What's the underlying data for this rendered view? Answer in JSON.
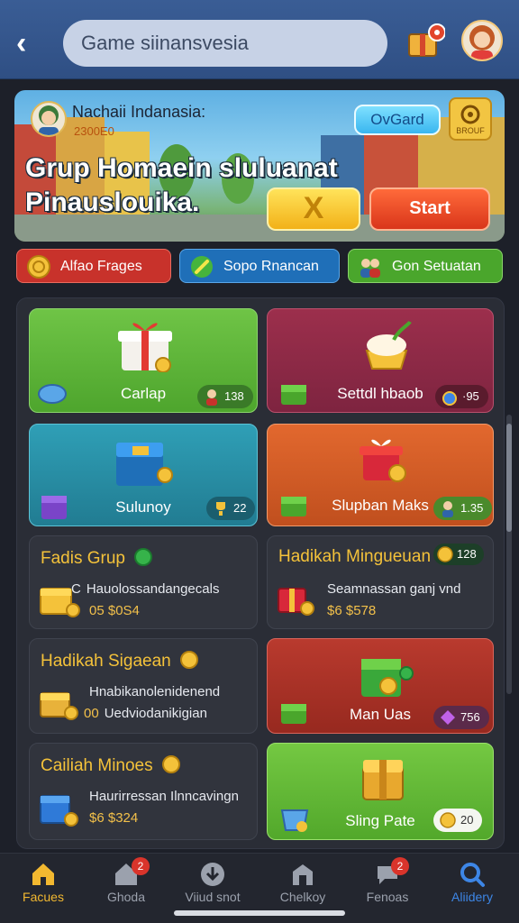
{
  "header": {
    "search_text": "Game siinansvesia"
  },
  "banner": {
    "user_name": "Nachaii Indanasia:",
    "coins": "2300E0",
    "tag_label": "OvGard",
    "badge_label": "BROUF",
    "title_line1": "Grup Homaein sluluanat",
    "title_line2": "Pinauslouika.",
    "x_button": "X",
    "start_button": "Start"
  },
  "categories": [
    {
      "label": "Alfao Frages",
      "color": "#c8322b"
    },
    {
      "label": "Sopo Rnancan",
      "color": "#1f6fb8"
    },
    {
      "label": "Gon Setuatan",
      "color": "#4aa62c"
    }
  ],
  "cards": {
    "carlap": {
      "title": "Carlap",
      "chip": "138"
    },
    "settdl": {
      "title": "Settdl hbaob",
      "chip": "·95"
    },
    "sulunoy": {
      "title": "Sulunoy",
      "chip": "22"
    },
    "slupban": {
      "title": "Slupban Maks",
      "chip": "1.35"
    },
    "fadis": {
      "title": "Fadis Grup",
      "line1": "Hauolossandangecals",
      "line1_prefix": "C",
      "line2": "05 $0S4"
    },
    "hadikah_mingu": {
      "title": "Hadikah Minguеuan",
      "badge": "128",
      "line1": "Seamnassan ganj vnd",
      "line2": "$6 $578"
    },
    "hadikah_sigaean": {
      "title": "Hadikah Sigaean",
      "line1": "Hnabikanolenidenend",
      "line2": "Uedviodanikigian",
      "line2_prefix": "00"
    },
    "man_uas": {
      "title": "Man Uas",
      "chip": "756"
    },
    "cailiah": {
      "title": "Cailiah Minoes",
      "line1": "Haurirressan Ilnncavingn",
      "line2": "$6 $324"
    },
    "sling_pate": {
      "title": "Sling Pate",
      "chip": "20"
    }
  },
  "nav": [
    {
      "label": "Facues",
      "icon": "home-icon",
      "active": true,
      "color": "#f2b830"
    },
    {
      "label": "Ghoda",
      "icon": "house-icon",
      "badge": "2"
    },
    {
      "label": "Viiud snot",
      "icon": "download-icon"
    },
    {
      "label": "Chelkoy",
      "icon": "shop-icon"
    },
    {
      "label": "Fenoas",
      "icon": "chat-icon",
      "badge": "2"
    },
    {
      "label": "Aliidery",
      "icon": "search-icon",
      "active_blue": true,
      "color": "#3d86e6"
    }
  ]
}
